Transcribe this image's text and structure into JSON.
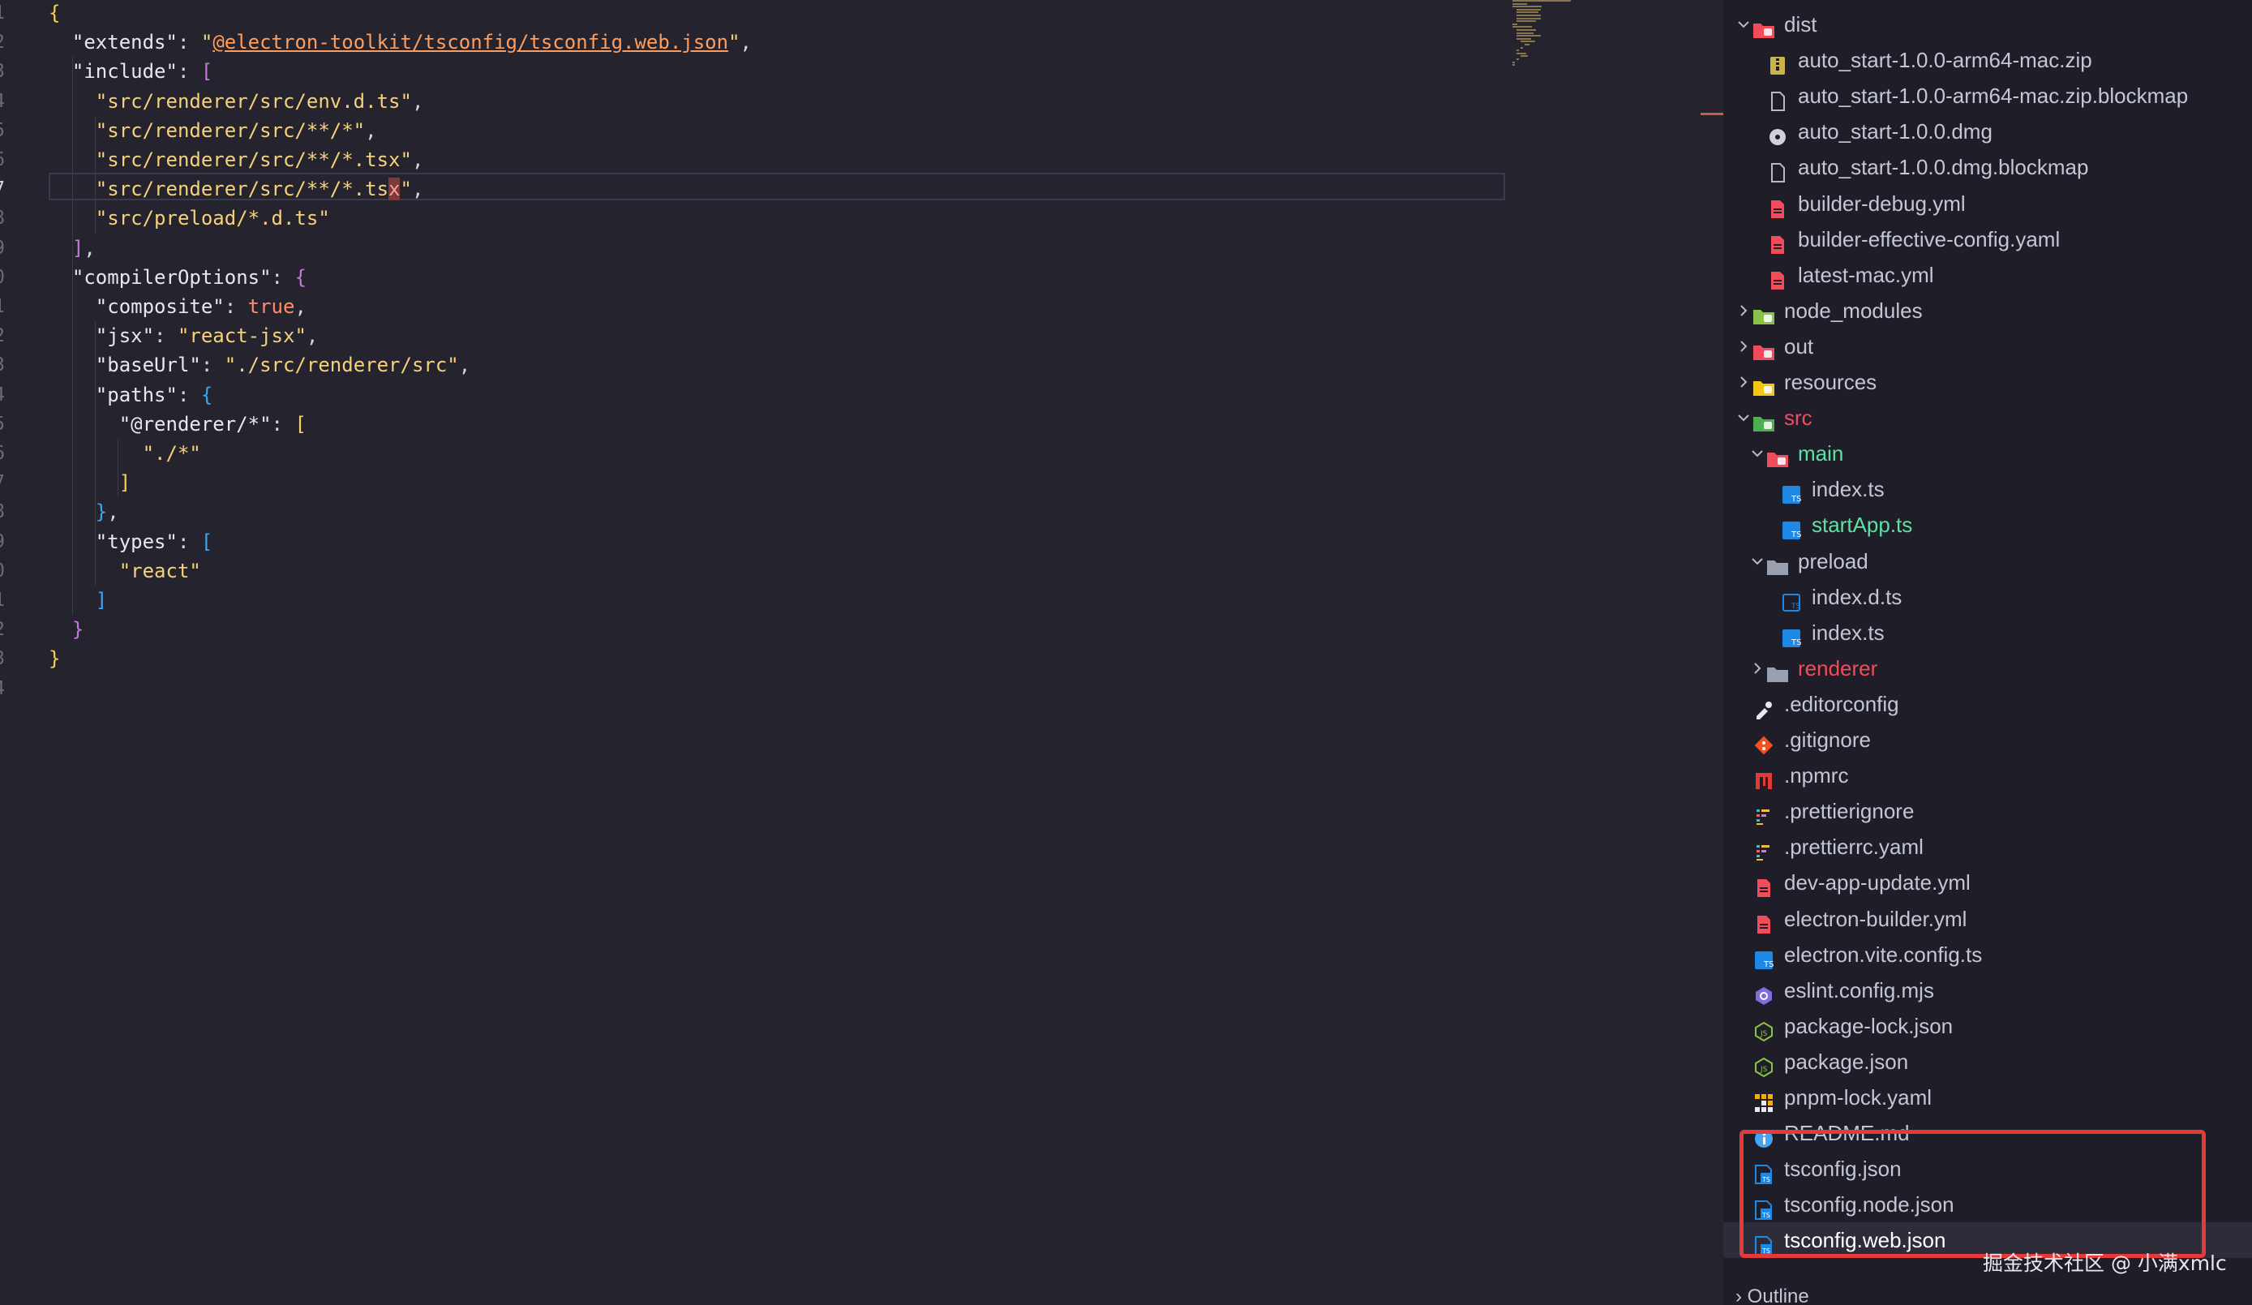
{
  "editor": {
    "active_line": 7,
    "line_numbers": [
      "1",
      "2",
      "3",
      "4",
      "5",
      "6",
      "7",
      "8",
      "9",
      "0",
      "1",
      "2",
      "3",
      "4",
      "5",
      "6",
      "7",
      "8",
      "9",
      "0",
      "1",
      "2",
      "3",
      "4"
    ],
    "lines": [
      [
        [
          "b1",
          "{"
        ]
      ],
      [
        [
          "c",
          "  "
        ],
        [
          "k",
          "\"extends\""
        ],
        [
          "c",
          ": "
        ],
        [
          "s",
          "\""
        ],
        [
          "u",
          "@electron-toolkit/tsconfig/tsconfig.web.json"
        ],
        [
          "s",
          "\""
        ],
        [
          "c",
          ","
        ]
      ],
      [
        [
          "c",
          "  "
        ],
        [
          "k",
          "\"include\""
        ],
        [
          "c",
          ": "
        ],
        [
          "b2",
          "["
        ]
      ],
      [
        [
          "c",
          "    "
        ],
        [
          "s",
          "\"src/renderer/src/env.d.ts\""
        ],
        [
          "c",
          ","
        ]
      ],
      [
        [
          "c",
          "    "
        ],
        [
          "s",
          "\"src/renderer/src/**/*\""
        ],
        [
          "c",
          ","
        ]
      ],
      [
        [
          "c",
          "    "
        ],
        [
          "s",
          "\"src/renderer/src/**/*.tsx\""
        ],
        [
          "c",
          ","
        ]
      ],
      [
        [
          "c",
          "    "
        ],
        [
          "s",
          "\"src/renderer/src/**/*.ts"
        ],
        [
          "cursor-hl",
          "x"
        ],
        [
          "s",
          "\""
        ],
        [
          "c",
          ","
        ]
      ],
      [
        [
          "c",
          "    "
        ],
        [
          "s",
          "\"src/preload/*.d.ts\""
        ]
      ],
      [
        [
          "c",
          "  "
        ],
        [
          "b2",
          "]"
        ],
        [
          "c",
          ","
        ]
      ],
      [
        [
          "c",
          "  "
        ],
        [
          "k",
          "\"compilerOptions\""
        ],
        [
          "c",
          ": "
        ],
        [
          "b2",
          "{"
        ]
      ],
      [
        [
          "c",
          "    "
        ],
        [
          "k",
          "\"composite\""
        ],
        [
          "c",
          ": "
        ],
        [
          "kw",
          "true"
        ],
        [
          "c",
          ","
        ]
      ],
      [
        [
          "c",
          "    "
        ],
        [
          "k",
          "\"jsx\""
        ],
        [
          "c",
          ": "
        ],
        [
          "s",
          "\"react-jsx\""
        ],
        [
          "c",
          ","
        ]
      ],
      [
        [
          "c",
          "    "
        ],
        [
          "k",
          "\"baseUrl\""
        ],
        [
          "c",
          ": "
        ],
        [
          "s",
          "\"./src/renderer/src\""
        ],
        [
          "c",
          ","
        ]
      ],
      [
        [
          "c",
          "    "
        ],
        [
          "k",
          "\"paths\""
        ],
        [
          "c",
          ": "
        ],
        [
          "b3",
          "{"
        ]
      ],
      [
        [
          "c",
          "      "
        ],
        [
          "k",
          "\"@renderer/*\""
        ],
        [
          "c",
          ": "
        ],
        [
          "b1",
          "["
        ]
      ],
      [
        [
          "c",
          "        "
        ],
        [
          "s",
          "\"./*\""
        ]
      ],
      [
        [
          "c",
          "      "
        ],
        [
          "b1",
          "]"
        ]
      ],
      [
        [
          "c",
          "    "
        ],
        [
          "b3",
          "}"
        ],
        [
          "c",
          ","
        ]
      ],
      [
        [
          "c",
          "    "
        ],
        [
          "k",
          "\"types\""
        ],
        [
          "c",
          ": "
        ],
        [
          "b3",
          "["
        ]
      ],
      [
        [
          "c",
          "      "
        ],
        [
          "s",
          "\"react\""
        ]
      ],
      [
        [
          "c",
          "    "
        ],
        [
          "b3",
          "]"
        ]
      ],
      [
        [
          "c",
          "  "
        ],
        [
          "b2",
          "}"
        ]
      ],
      [
        [
          "b1",
          "}"
        ]
      ],
      []
    ]
  },
  "explorer": {
    "items": [
      {
        "name": "dist",
        "type": "folder-open",
        "depth": 0,
        "icon": "dist-folder-icon",
        "color": "#f14c5c",
        "text_color": "default"
      },
      {
        "name": "auto_start-1.0.0-arm64-mac.zip",
        "type": "file",
        "depth": 1,
        "icon": "zip-icon",
        "color": "#c9b44a"
      },
      {
        "name": "auto_start-1.0.0-arm64-mac.zip.blockmap",
        "type": "file",
        "depth": 1,
        "icon": "file-icon",
        "color": "#b8b8c8"
      },
      {
        "name": "auto_start-1.0.0.dmg",
        "type": "file",
        "depth": 1,
        "icon": "disk-icon",
        "color": "#d0d0d8"
      },
      {
        "name": "auto_start-1.0.0.dmg.blockmap",
        "type": "file",
        "depth": 1,
        "icon": "file-icon",
        "color": "#b8b8c8"
      },
      {
        "name": "builder-debug.yml",
        "type": "file",
        "depth": 1,
        "icon": "yaml-icon",
        "color": "#f14c5c"
      },
      {
        "name": "builder-effective-config.yaml",
        "type": "file",
        "depth": 1,
        "icon": "yaml-icon",
        "color": "#f14c5c"
      },
      {
        "name": "latest-mac.yml",
        "type": "file",
        "depth": 1,
        "icon": "yaml-icon",
        "color": "#f14c5c"
      },
      {
        "name": "node_modules",
        "type": "folder-closed",
        "depth": 0,
        "icon": "node-folder-icon",
        "color": "#8bc34a"
      },
      {
        "name": "out",
        "type": "folder-closed",
        "depth": 0,
        "icon": "out-folder-icon",
        "color": "#f14c5c"
      },
      {
        "name": "resources",
        "type": "folder-closed",
        "depth": 0,
        "icon": "resources-folder-icon",
        "color": "#f5c518"
      },
      {
        "name": "src",
        "type": "folder-open",
        "depth": 0,
        "icon": "src-folder-icon",
        "color": "#4caf50",
        "text_color": "red"
      },
      {
        "name": "main",
        "type": "folder-open",
        "depth": 1,
        "icon": "main-folder-icon",
        "color": "#f14c5c",
        "text_color": "green"
      },
      {
        "name": "index.ts",
        "type": "file",
        "depth": 2,
        "icon": "typescript-icon",
        "color": "#1e88e5"
      },
      {
        "name": "startApp.ts",
        "type": "file",
        "depth": 2,
        "icon": "typescript-icon",
        "color": "#1e88e5",
        "text_color": "green"
      },
      {
        "name": "preload",
        "type": "folder-open",
        "depth": 1,
        "icon": "folder-icon",
        "color": "#9aa0b0"
      },
      {
        "name": "index.d.ts",
        "type": "file",
        "depth": 2,
        "icon": "typescript-def-icon",
        "color": "#1e88e5"
      },
      {
        "name": "index.ts",
        "type": "file",
        "depth": 2,
        "icon": "typescript-icon",
        "color": "#1e88e5"
      },
      {
        "name": "renderer",
        "type": "folder-closed",
        "depth": 1,
        "icon": "folder-icon",
        "color": "#9aa0b0",
        "text_color": "red"
      },
      {
        "name": ".editorconfig",
        "type": "file",
        "depth": 0,
        "icon": "editorconfig-icon",
        "color": "#e8e8ec"
      },
      {
        "name": ".gitignore",
        "type": "file",
        "depth": 0,
        "icon": "git-icon",
        "color": "#f4511e"
      },
      {
        "name": ".npmrc",
        "type": "file",
        "depth": 0,
        "icon": "npm-icon",
        "color": "#e53935"
      },
      {
        "name": ".prettierignore",
        "type": "file",
        "depth": 0,
        "icon": "prettier-icon",
        "color": "#56b3b4"
      },
      {
        "name": ".prettierrc.yaml",
        "type": "file",
        "depth": 0,
        "icon": "prettier-icon",
        "color": "#56b3b4"
      },
      {
        "name": "dev-app-update.yml",
        "type": "file",
        "depth": 0,
        "icon": "yaml-icon",
        "color": "#f14c5c"
      },
      {
        "name": "electron-builder.yml",
        "type": "file",
        "depth": 0,
        "icon": "yaml-icon",
        "color": "#f14c5c"
      },
      {
        "name": "electron.vite.config.ts",
        "type": "file",
        "depth": 0,
        "icon": "typescript-icon",
        "color": "#1e88e5"
      },
      {
        "name": "eslint.config.mjs",
        "type": "file",
        "depth": 0,
        "icon": "eslint-icon",
        "color": "#7c6fe0"
      },
      {
        "name": "package-lock.json",
        "type": "file",
        "depth": 0,
        "icon": "nodejs-icon",
        "color": "#8bc34a"
      },
      {
        "name": "package.json",
        "type": "file",
        "depth": 0,
        "icon": "nodejs-icon",
        "color": "#8bc34a"
      },
      {
        "name": "pnpm-lock.yaml",
        "type": "file",
        "depth": 0,
        "icon": "pnpm-icon",
        "color": "#f9ad00"
      },
      {
        "name": "README.md",
        "type": "file",
        "depth": 0,
        "icon": "info-icon",
        "color": "#42a5f5"
      },
      {
        "name": "tsconfig.json",
        "type": "file",
        "depth": 0,
        "icon": "tsconfig-icon",
        "color": "#1e88e5"
      },
      {
        "name": "tsconfig.node.json",
        "type": "file",
        "depth": 0,
        "icon": "tsconfig-icon",
        "color": "#1e88e5"
      },
      {
        "name": "tsconfig.web.json",
        "type": "file",
        "depth": 0,
        "icon": "tsconfig-icon",
        "color": "#1e88e5",
        "selected": true
      }
    ]
  },
  "outline_label": "Outline",
  "watermark": "掘金技术社区 @ 小满xmlc",
  "colors": {
    "editor_bg": "#24232e",
    "sidebar_bg": "#1f1e28",
    "highlight_box": "#e53a3a"
  }
}
